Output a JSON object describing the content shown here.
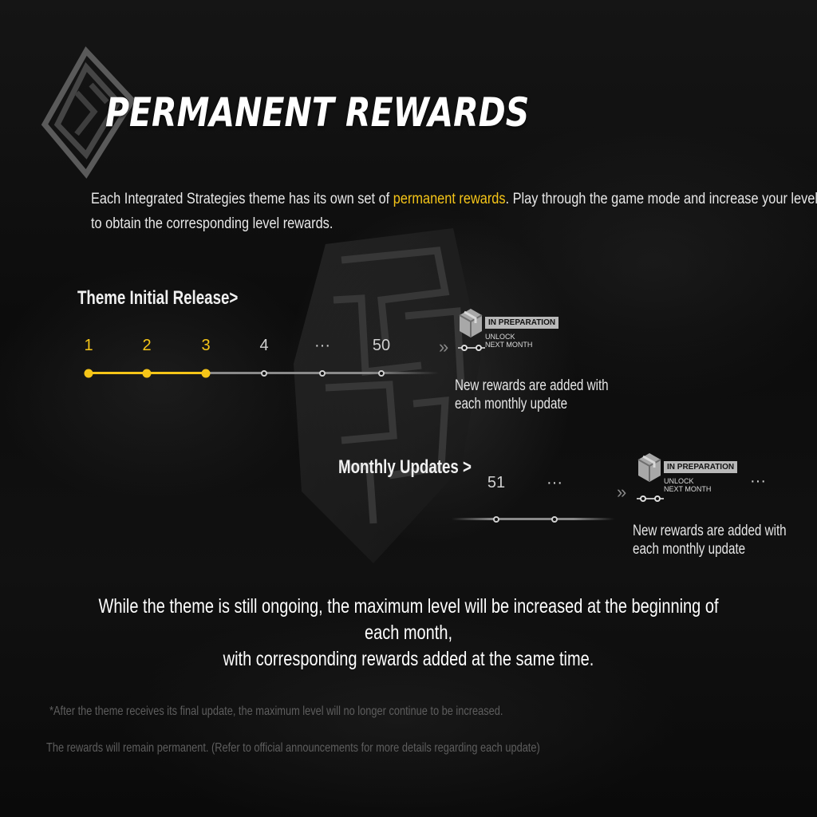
{
  "header": {
    "title": "PERMANENT REWARDS",
    "intro_before": "Each Integrated Strategies theme has its own set of ",
    "intro_highlight": "permanent rewards",
    "intro_after": ". Play through the game mode and increase your level",
    "intro_line2": "to obtain the corresponding level rewards."
  },
  "initial_release": {
    "label": "Theme Initial Release>",
    "ticks": [
      {
        "label": "1",
        "active": true
      },
      {
        "label": "2",
        "active": true
      },
      {
        "label": "3",
        "active": true
      },
      {
        "label": "4",
        "active": false
      },
      {
        "label": "···",
        "active": false
      },
      {
        "label": "50",
        "active": false
      }
    ],
    "arrow": "»",
    "badge": "IN PREPARATION",
    "unlock_line1": "UNLOCK",
    "unlock_line2": "NEXT MONTH",
    "note_line1": "New rewards are added with",
    "note_line2": "each monthly update"
  },
  "monthly_updates": {
    "label": "Monthly Updates >",
    "ticks": [
      {
        "label": "51",
        "active": false
      },
      {
        "label": "···",
        "active": false
      }
    ],
    "arrow": "»",
    "badge": "IN PREPARATION",
    "unlock_line1": "UNLOCK",
    "unlock_line2": "NEXT MONTH",
    "trailing": "···",
    "note_line1": "New rewards are added with",
    "note_line2": "each monthly update"
  },
  "summary": {
    "line1": "While the theme is still ongoing, the maximum level will be increased at the beginning of each month,",
    "line2": "with corresponding rewards added at the same time."
  },
  "footnote": {
    "line1": "*After the theme receives its final update, the maximum level will no longer continue to be increased.",
    "line2": "The rewards will remain permanent. (Refer to official announcements for more details regarding each update)"
  },
  "colors": {
    "accent": "#f5c518",
    "inactive": "#cfcfcf",
    "background": "#0e0e0e"
  },
  "icons": [
    "maze-logo-icon",
    "maze-pillar-icon",
    "reward-box-icon",
    "double-chevron-icon"
  ]
}
